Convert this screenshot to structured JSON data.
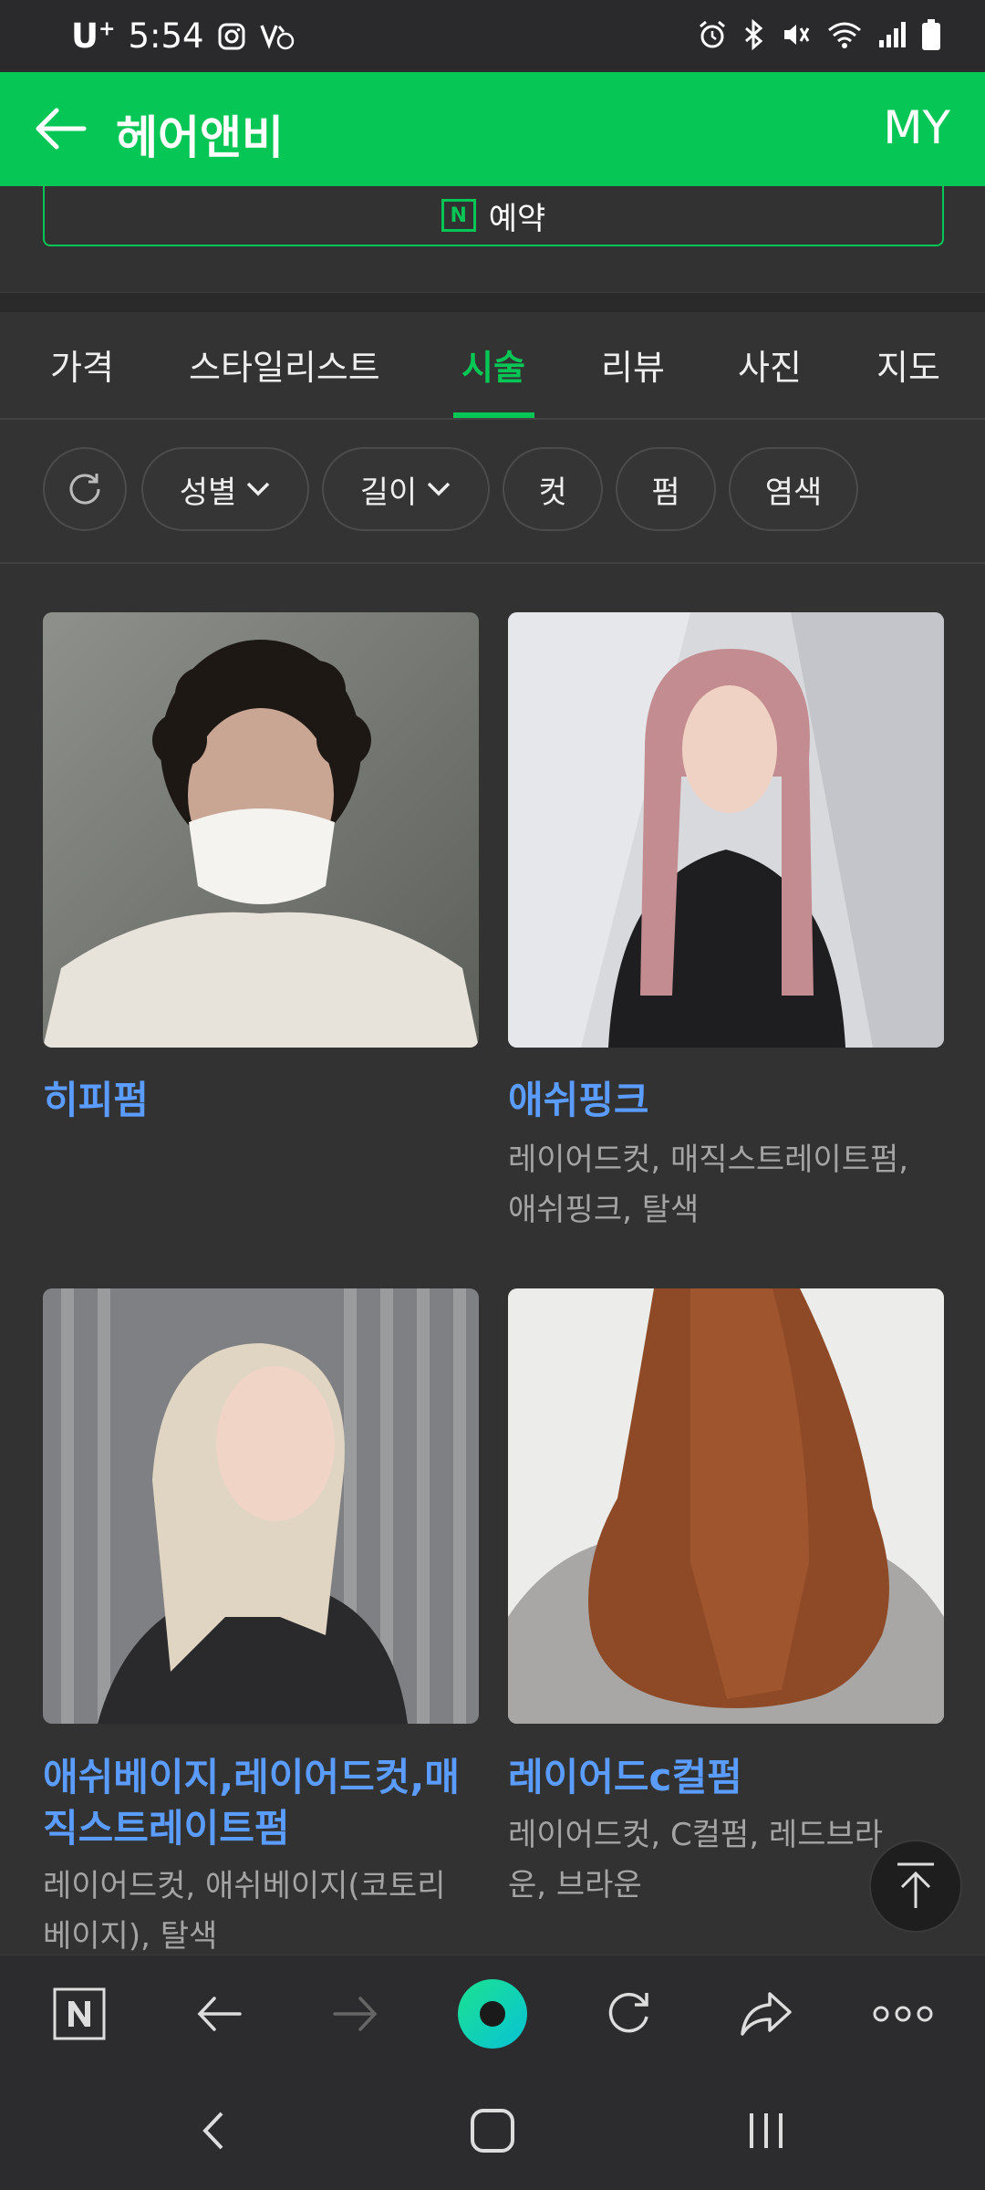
{
  "status_bar": {
    "carrier": "U",
    "carrier_sup": "+",
    "time": "5:54",
    "icons_left": [
      "instagram-icon",
      "volte-icon"
    ],
    "icons_right": [
      "alarm-icon",
      "bluetooth-icon",
      "mute-icon",
      "wifi-icon",
      "signal-icon",
      "battery-icon"
    ]
  },
  "app_bar": {
    "title": "헤어앤비",
    "my_label": "MY"
  },
  "reserve": {
    "badge": "N",
    "label": "예약"
  },
  "tabs": [
    {
      "label": "가격",
      "active": false
    },
    {
      "label": "스타일리스트",
      "active": false
    },
    {
      "label": "시술",
      "active": true
    },
    {
      "label": "리뷰",
      "active": false
    },
    {
      "label": "사진",
      "active": false
    },
    {
      "label": "지도",
      "active": false
    }
  ],
  "filters": {
    "reset_icon": "refresh-icon",
    "chips": [
      {
        "label": "성별",
        "dropdown": true
      },
      {
        "label": "길이",
        "dropdown": true
      },
      {
        "label": "컷",
        "dropdown": false
      },
      {
        "label": "펌",
        "dropdown": false
      },
      {
        "label": "염색",
        "dropdown": false
      }
    ]
  },
  "styles": [
    {
      "title": "히피펌",
      "subtitle": ""
    },
    {
      "title": "애쉬핑크",
      "subtitle": "레이어드컷, 매직스트레이트펌, 애쉬핑크, 탈색"
    },
    {
      "title": "애쉬베이지,레이어드컷,매직스트레이트펌",
      "subtitle": "레이어드컷, 애쉬베이지(코토리베이지), 탈색"
    },
    {
      "title": "레이어드c컬펌",
      "subtitle": "레이어드컷, C컬펌, 레드브라운, 브라운"
    }
  ],
  "colors": {
    "accent": "#06c755",
    "link": "#5a9cff",
    "background": "#323232"
  }
}
